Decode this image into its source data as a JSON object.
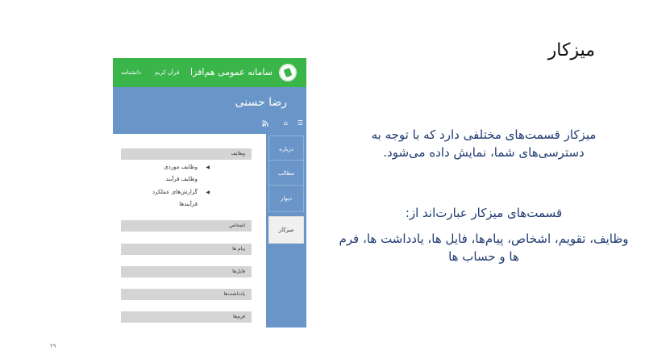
{
  "slide": {
    "title": "میزکار",
    "description": "میزکار قسمت‌های مختلفی دارد که با توجه به دسترسی‌های شما، نمایش داده می‌شود.",
    "sections_heading": "قسمت‌های میزکار عبارت‌اند از:",
    "sections_list": "وظایف، تقویم، اشخاص، پیام‌ها، فایل ها، یادداشت ها، فرم ها و حساب ها",
    "page_number": "۲۹"
  },
  "app": {
    "name": "سامانه عمومی هم‌افزا",
    "nav": {
      "quran": "قرآن کریم",
      "daneshnameh": "دانشنامه"
    },
    "brand_color": "#39b54a",
    "accent_color": "#6a95c8",
    "user": {
      "name": "رضا حسنی"
    },
    "toolbar_icons": [
      "menu-icon",
      "home-icon",
      "rss-icon"
    ],
    "tabs": [
      {
        "label": "درباره",
        "active": false
      },
      {
        "label": "مطالب",
        "active": false
      },
      {
        "label": "دیوار",
        "active": false
      },
      {
        "label": "میزکار",
        "active": true
      }
    ],
    "panel": {
      "tasks": {
        "header": "وظایف",
        "items": [
          "وظایف موردی",
          "وظایف فرآیند",
          "گزارش‌های عملکرد",
          "فرآیندها"
        ]
      },
      "persons": "اشخاص",
      "messages": "پیام ها",
      "files": "فایل‌ها",
      "notes": "یادداشت‌ها",
      "forms": "فرم‌ها"
    }
  }
}
